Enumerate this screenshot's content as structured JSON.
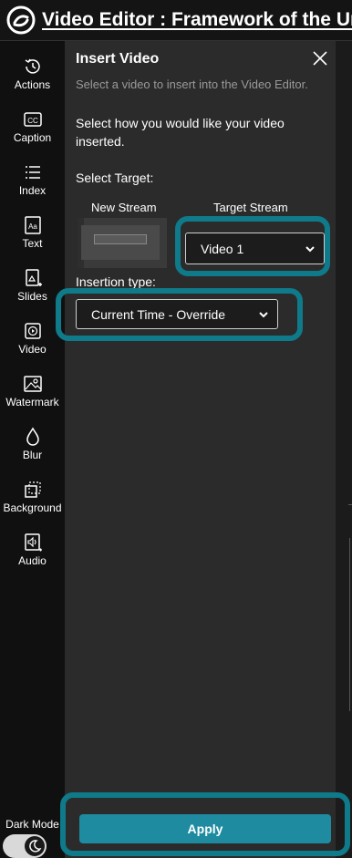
{
  "app": {
    "title": "Video Editor : Framework of the Uni"
  },
  "sidebar": {
    "items": [
      {
        "label": "Actions",
        "icon": "history-icon"
      },
      {
        "label": "Caption",
        "icon": "cc-icon"
      },
      {
        "label": "Index",
        "icon": "list-icon"
      },
      {
        "label": "Text",
        "icon": "text-aa-icon"
      },
      {
        "label": "Slides",
        "icon": "slides-icon"
      },
      {
        "label": "Video",
        "icon": "video-play-icon"
      },
      {
        "label": "Watermark",
        "icon": "image-icon"
      },
      {
        "label": "Blur",
        "icon": "droplet-icon"
      },
      {
        "label": "Background",
        "icon": "background-icon"
      },
      {
        "label": "Audio",
        "icon": "audio-icon"
      }
    ],
    "dark_mode_label": "Dark Mode",
    "dark_mode_on": true
  },
  "panel": {
    "title": "Insert Video",
    "subtitle": "Select a video to insert into the Video Editor.",
    "description": "Select how you would like your video inserted.",
    "select_target_label": "Select Target:",
    "new_stream_label": "New Stream",
    "target_stream_label": "Target Stream",
    "target_stream_value": "Video 1",
    "insertion_type_label": "Insertion type:",
    "insertion_type_value": "Current Time - Override",
    "apply_label": "Apply"
  },
  "colors": {
    "highlight": "#0f7a8a",
    "apply_button": "#1e8ba0",
    "panel_bg": "#2b2b2b",
    "sidebar_bg": "#101010"
  }
}
